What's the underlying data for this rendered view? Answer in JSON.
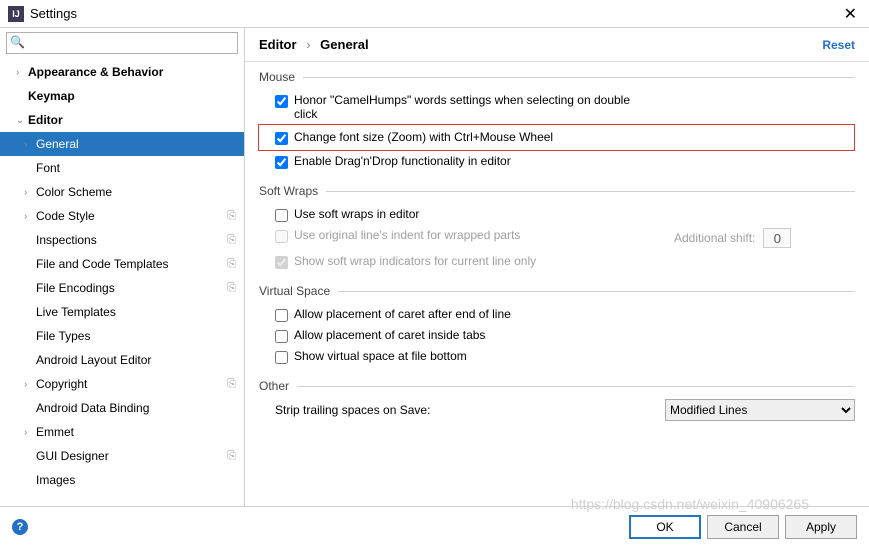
{
  "window": {
    "title": "Settings"
  },
  "search": {
    "placeholder": ""
  },
  "breadcrumb": {
    "parent": "Editor",
    "current": "General",
    "reset": "Reset"
  },
  "tree": {
    "items": [
      {
        "label": "Appearance & Behavior",
        "lvl": 1,
        "bold": true,
        "arrow": true
      },
      {
        "label": "Keymap",
        "lvl": 1,
        "bold": true
      },
      {
        "label": "Editor",
        "lvl": 1,
        "bold": true,
        "arrow": true,
        "expanded": true
      },
      {
        "label": "General",
        "lvl": 2,
        "arrow": true,
        "selected": true
      },
      {
        "label": "Font",
        "lvl": 2
      },
      {
        "label": "Color Scheme",
        "lvl": 2,
        "arrow": true
      },
      {
        "label": "Code Style",
        "lvl": 2,
        "arrow": true,
        "badge": true
      },
      {
        "label": "Inspections",
        "lvl": 2,
        "badge": true
      },
      {
        "label": "File and Code Templates",
        "lvl": 2,
        "badge": true
      },
      {
        "label": "File Encodings",
        "lvl": 2,
        "badge": true
      },
      {
        "label": "Live Templates",
        "lvl": 2
      },
      {
        "label": "File Types",
        "lvl": 2
      },
      {
        "label": "Android Layout Editor",
        "lvl": 2
      },
      {
        "label": "Copyright",
        "lvl": 2,
        "arrow": true,
        "badge": true
      },
      {
        "label": "Android Data Binding",
        "lvl": 2
      },
      {
        "label": "Emmet",
        "lvl": 2,
        "arrow": true
      },
      {
        "label": "GUI Designer",
        "lvl": 2,
        "badge": true
      },
      {
        "label": "Images",
        "lvl": 2
      }
    ]
  },
  "sections": {
    "mouse": {
      "title": "Mouse",
      "honor": "Honor \"CamelHumps\" words settings when selecting on double click",
      "zoom": "Change font size (Zoom) with Ctrl+Mouse Wheel",
      "dnd": "Enable Drag'n'Drop functionality in editor"
    },
    "softwraps": {
      "title": "Soft Wraps",
      "use": "Use soft wraps in editor",
      "indent": "Use original line's indent for wrapped parts",
      "addshift_label": "Additional shift:",
      "addshift_value": "0",
      "indicators": "Show soft wrap indicators for current line only"
    },
    "virtual": {
      "title": "Virtual Space",
      "caret_eol": "Allow placement of caret after end of line",
      "caret_tabs": "Allow placement of caret inside tabs",
      "show_bottom": "Show virtual space at file bottom"
    },
    "other": {
      "title": "Other",
      "strip_label": "Strip trailing spaces on Save:",
      "strip_value": "Modified Lines"
    }
  },
  "buttons": {
    "ok": "OK",
    "cancel": "Cancel",
    "apply": "Apply"
  },
  "watermark": "https://blog.csdn.net/weixin_40906265"
}
